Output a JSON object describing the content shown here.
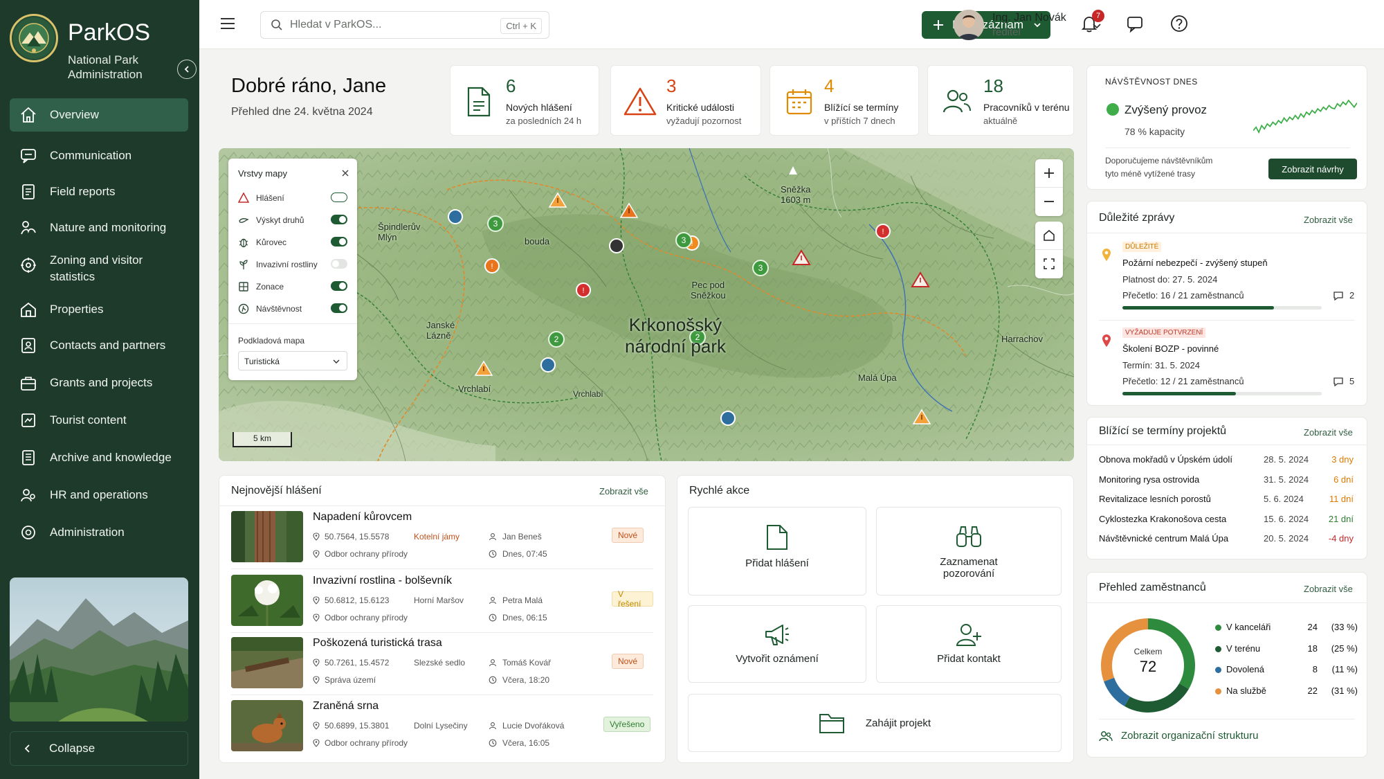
{
  "app": {
    "name": "ParkOS",
    "subtitle_line1": "National Park",
    "subtitle_line2": "Administration",
    "logo_text": "NÁRODNÍ PARK"
  },
  "sidebar": {
    "items": [
      {
        "label": "Overview",
        "icon": "home-icon",
        "active": true
      },
      {
        "label": "Communication",
        "icon": "chat-icon"
      },
      {
        "label": "Field reports",
        "icon": "report-icon"
      },
      {
        "label": "Nature and monitoring",
        "icon": "nature-icon"
      },
      {
        "label": "Zoning and visitor",
        "label2": "statistics",
        "icon": "zoning-icon"
      },
      {
        "label": "Properties",
        "icon": "properties-icon"
      },
      {
        "label": "Contacts and partners",
        "icon": "contacts-icon"
      },
      {
        "label": "Grants and projects",
        "icon": "grants-icon"
      },
      {
        "label": "Tourist content",
        "icon": "tourist-icon"
      },
      {
        "label": "Archive and knowledge",
        "icon": "archive-icon"
      },
      {
        "label": "HR and operations",
        "icon": "hr-icon"
      },
      {
        "label": "Administration",
        "icon": "admin-icon"
      }
    ],
    "collapse_label": "Collapse"
  },
  "topbar": {
    "search_placeholder": "Hledat v ParkOS...",
    "search_shortcut": "Ctrl + K",
    "new_button": "Nový záznam",
    "notification_count": "7",
    "user_name": "Ing. Jan Novák",
    "user_role": "ředitel"
  },
  "greeting": {
    "title": "Dobré ráno, Jane",
    "subtitle": "Přehled dne 24. května 2024"
  },
  "stats": [
    {
      "value": "6",
      "line1": "Nových hlášení",
      "line2": "za posledních 24 h",
      "icon": "document-icon",
      "color": "#1e5b33"
    },
    {
      "value": "3",
      "line1": "Kritické události",
      "line2": "vyžadují pozornost",
      "icon": "warning-icon",
      "color": "#d84315"
    },
    {
      "value": "4",
      "line1": "Blížící se termíny",
      "line2": "v příštích 7 dnech",
      "icon": "calendar-icon",
      "color": "#e08a00"
    },
    {
      "value": "18",
      "line1": "Pracovníků v terénu",
      "line2": "aktuálně",
      "icon": "people-icon",
      "color": "#1e5b33"
    }
  ],
  "visitors": {
    "title": "NÁVŠTĚVNOST DNES",
    "status": "Zvýšený provoz",
    "capacity": "78 % kapacity",
    "recommend_line1": "Doporučujeme návštěvníkům",
    "recommend_line2": "tyto méně vytížené trasy",
    "button": "Zobrazit návrhy",
    "sparkline": [
      20,
      24,
      18,
      26,
      22,
      28,
      25,
      30,
      27,
      32,
      29,
      35,
      31,
      36,
      33,
      38,
      34,
      40,
      36,
      42,
      39,
      44,
      41,
      46,
      43,
      48,
      45,
      50,
      47,
      46,
      52,
      49,
      54,
      51,
      56,
      52,
      48,
      53
    ]
  },
  "map": {
    "layers_title": "Vrstvy mapy",
    "layers": [
      {
        "label": "Hlášení",
        "on": true,
        "partial": true
      },
      {
        "label": "Výskyt druhů",
        "on": true
      },
      {
        "label": "Kůrovec",
        "on": true
      },
      {
        "label": "Invazivní rostliny",
        "on": false
      },
      {
        "label": "Zonace",
        "on": true
      },
      {
        "label": "Návštěvnost",
        "on": true
      }
    ],
    "basemap_label": "Podkladová mapa",
    "basemap_value": "Turistická",
    "scale": "5 km",
    "park_name_line1": "Krkonošský",
    "park_name_line2": "národní park",
    "places": [
      {
        "name": "Sněžka",
        "name2": "1603 m"
      },
      {
        "name": "Špindlerův",
        "name2": "Mlýn"
      },
      {
        "name": "bouda"
      },
      {
        "name": "Pec pod",
        "name2": "Sněžkou"
      },
      {
        "name": "Janské",
        "name2": "Lázně"
      },
      {
        "name": "Harrachov"
      },
      {
        "name": "Malá Úpa"
      },
      {
        "name": "Vrchlabí"
      },
      {
        "name": "Vrchlabí"
      }
    ],
    "cluster_labels": [
      "3",
      "3",
      "2",
      "3",
      "2"
    ]
  },
  "reports": {
    "title": "Nejnovější hlášení",
    "link": "Zobrazit vše",
    "items": [
      {
        "title": "Napadení kůrovcem",
        "coords": "50.7564, 15.5578",
        "place": "Kotelní jámy",
        "dept": "Odbor ochrany přírody",
        "person": "Jan Beneš",
        "time": "Dnes, 07:45",
        "status": "Nové",
        "status_color": "#c0501b",
        "status_bg": "#fdeadb"
      },
      {
        "title": "Invazivní rostlina - bolševník",
        "coords": "50.6812, 15.6123",
        "place": "Horní Maršov",
        "dept": "Odbor ochrany přírody",
        "person": "Petra Malá",
        "time": "Dnes, 06:15",
        "status": "V řešení",
        "status_color": "#c08a00",
        "status_bg": "#fdf2d4"
      },
      {
        "title": "Poškozená turistická trasa",
        "coords": "50.7261, 15.4572",
        "place": "Slezské sedlo",
        "dept": "Správa území",
        "person": "Tomáš Kovář",
        "time": "Včera, 18:20",
        "status": "Nové",
        "status_color": "#c0501b",
        "status_bg": "#fdeadb"
      },
      {
        "title": "Zraněná srna",
        "coords": "50.6899, 15.3801",
        "place": "Dolní Lysečiny",
        "dept": "Odbor ochrany přírody",
        "person": "Lucie Dvořáková",
        "time": "Včera, 16:05",
        "status": "Vyřešeno",
        "status_color": "#2e7d32",
        "status_bg": "#e3f2dc"
      }
    ]
  },
  "quick_actions": {
    "title": "Rychlé akce",
    "items": [
      {
        "label": "Přidat hlášení",
        "icon": "add-document-icon"
      },
      {
        "label": "Zaznamenat",
        "label2": "pozorování",
        "icon": "binoculars-icon"
      },
      {
        "label": "Vytvořit oznámení",
        "icon": "megaphone-icon"
      },
      {
        "label": "Přidat kontakt",
        "icon": "add-user-icon"
      },
      {
        "label": "Zahájit projekt",
        "icon": "folder-icon"
      }
    ]
  },
  "messages": {
    "title": "Důležité zprávy",
    "link": "Zobrazit vše",
    "items": [
      {
        "chip": "DŮLEŽITÉ",
        "title": "Požární nebezpečí - zvýšený stupeň",
        "line2": "Platnost do: 27. 5. 2024",
        "line3": "Přečetlo: 16 / 21 zaměstnanců",
        "comments": "2",
        "read": 0.76
      },
      {
        "chip": "VYŽADUJE POTVRZENÍ",
        "title": "Školení BOZP - povinné",
        "line2": "Termín: 31. 5. 2024",
        "line3": "Přečetlo: 12 / 21 zaměstnanců",
        "comments": "5",
        "read": 0.57
      }
    ]
  },
  "deadlines": {
    "title": "Blížící se termíny projektů",
    "link": "Zobrazit vše",
    "items": [
      {
        "name": "Obnova mokřadů v Úpském údolí",
        "date": "28. 5. 2024",
        "days": "3 dny",
        "color": "#e07a00"
      },
      {
        "name": "Monitoring rysa ostrovida",
        "date": "31. 5. 2024",
        "days": "6 dní",
        "color": "#e07a00"
      },
      {
        "name": "Revitalizace lesních porostů",
        "date": "5. 6. 2024",
        "days": "11 dní",
        "color": "#e07a00"
      },
      {
        "name": "Cyklostezka Krakonošova cesta",
        "date": "15. 6. 2024",
        "days": "21 dní",
        "color": "#2e7d32"
      },
      {
        "name": "Návštěvnické centrum Malá Úpa",
        "date": "20. 5. 2024",
        "days": "-4 dny",
        "color": "#c62828"
      }
    ]
  },
  "employees": {
    "title": "Přehled zaměstnanců",
    "link": "Zobrazit vše",
    "total_label": "Celkem",
    "total": "72",
    "segments": [
      {
        "label": "V kanceláři",
        "count": "24",
        "pct": "(33 %)",
        "value": 24,
        "color": "#2e8b3e"
      },
      {
        "label": "V terénu",
        "count": "18",
        "pct": "(25 %)",
        "value": 18,
        "color": "#1e5b33"
      },
      {
        "label": "Dovolená",
        "count": "8",
        "pct": "(11 %)",
        "value": 8,
        "color": "#2d6e9e"
      },
      {
        "label": "Na službě",
        "count": "22",
        "pct": "(31 %)",
        "value": 22,
        "color": "#e6913e"
      }
    ],
    "org_link": "Zobrazit organizační strukturu"
  }
}
